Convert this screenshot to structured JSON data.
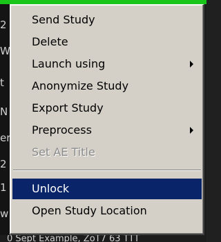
{
  "menu": {
    "items": [
      {
        "label": "Send Study",
        "enabled": true,
        "submenu": false
      },
      {
        "label": "Delete",
        "enabled": true,
        "submenu": false
      },
      {
        "label": "Launch using",
        "enabled": true,
        "submenu": true,
        "icon": "submenu-arrow-icon"
      },
      {
        "label": "Anonymize Study",
        "enabled": true,
        "submenu": false
      },
      {
        "label": "Export Study",
        "enabled": true,
        "submenu": false
      },
      {
        "label": "Preprocess",
        "enabled": true,
        "submenu": true,
        "icon": "submenu-arrow-icon"
      },
      {
        "label": "Set AE Title",
        "enabled": false,
        "submenu": false
      },
      {
        "label": "Unlock",
        "enabled": true,
        "submenu": false,
        "highlighted": true
      },
      {
        "label": "Open Study Location",
        "enabled": true,
        "submenu": false
      }
    ]
  },
  "background": {
    "left_fragments": [
      "2",
      "W",
      "t",
      "N",
      "er",
      "2",
      "1",
      "w"
    ],
    "bottom_fragment": "0 Sept Example, ZoT7 63 TTT"
  },
  "colors": {
    "menu_bg": "#d4d0c8",
    "highlight_bg": "#0a246a",
    "highlight_text": "#ffffff",
    "disabled_text": "#8a8a8a",
    "selected_row_strip": "#19c519"
  }
}
